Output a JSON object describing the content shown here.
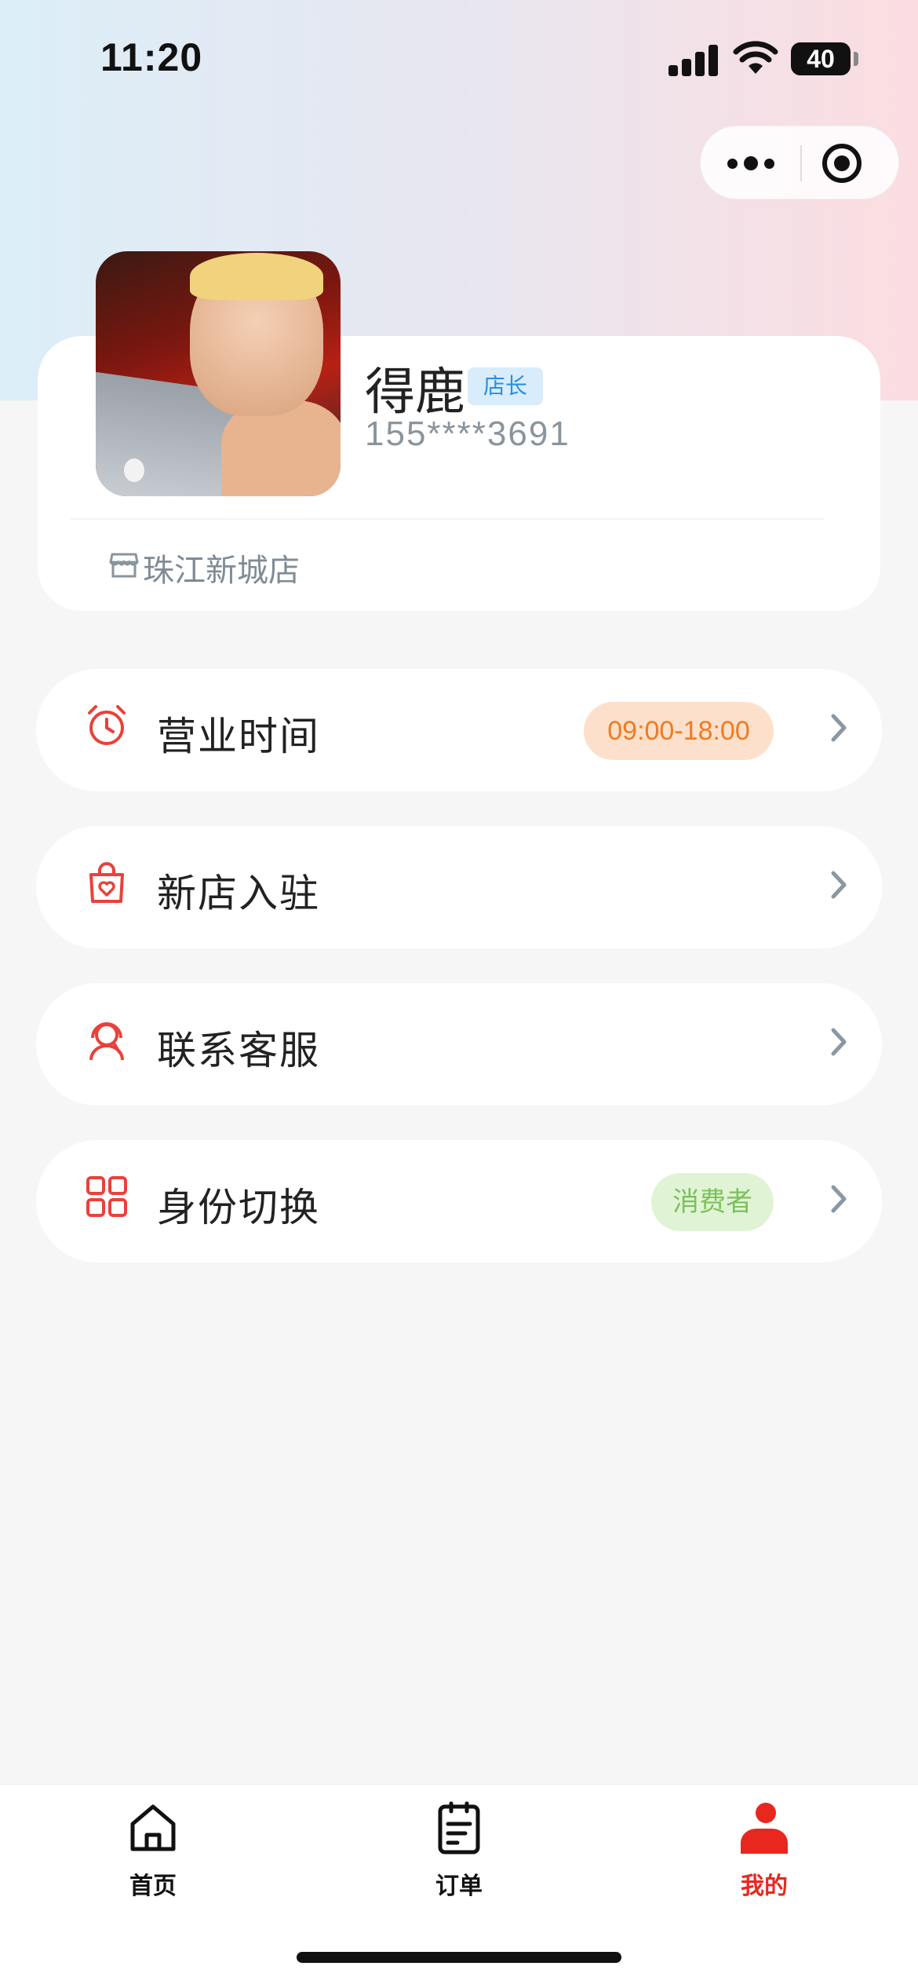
{
  "status_bar": {
    "time": "11:20",
    "battery": "40"
  },
  "capsule": {
    "more_icon": "more-dots-icon",
    "close_icon": "target-circle-icon"
  },
  "profile": {
    "name": "得鹿",
    "role": "店长",
    "phone": "155****3691",
    "store": "珠江新城店",
    "store_icon": "store-icon"
  },
  "menu": [
    {
      "label": "营业时间",
      "icon": "alarm-clock-icon",
      "value": "09:00-18:00",
      "value_color": "#f27a1e"
    },
    {
      "label": "新店入驻",
      "icon": "shopping-bag-heart-icon"
    },
    {
      "label": "联系客服",
      "icon": "customer-service-icon"
    },
    {
      "label": "身份切换",
      "icon": "grid-icon",
      "value": "消费者",
      "value_color": "#7bc15b"
    }
  ],
  "tabs": [
    {
      "label": "首页",
      "icon": "home-icon",
      "active": false
    },
    {
      "label": "订单",
      "icon": "order-list-icon",
      "active": false
    },
    {
      "label": "我的",
      "icon": "user-icon",
      "active": true
    }
  ],
  "colors": {
    "accent": "#e8281f",
    "icon_red": "#e9413a",
    "chevron": "#8a98a4"
  }
}
